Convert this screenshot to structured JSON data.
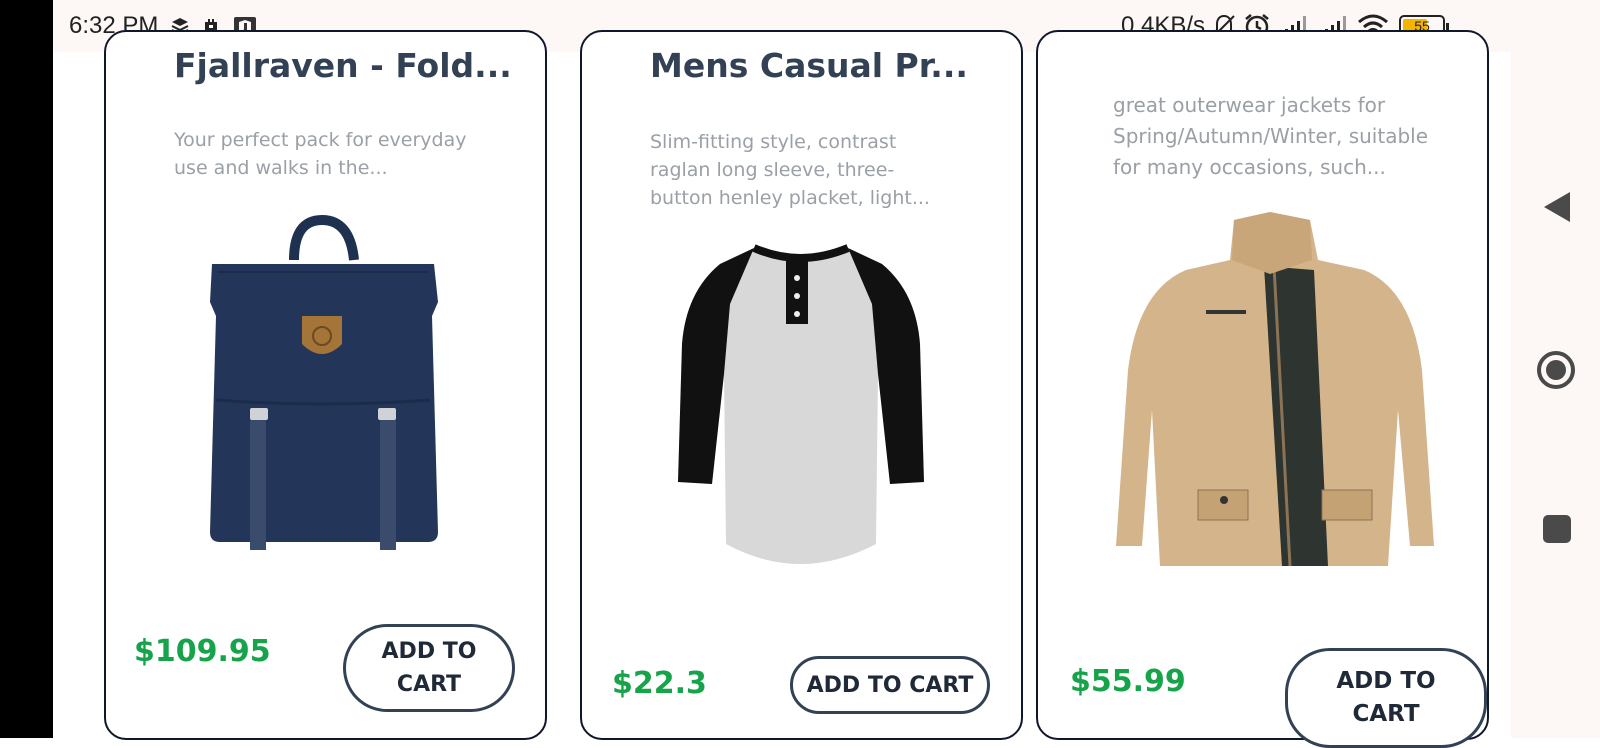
{
  "status_bar": {
    "time": "6:32 PM",
    "network_speed": "0.4KB/s",
    "battery": "55",
    "icons": [
      "layers-icon",
      "notification-icon",
      "app-icon",
      "mute-bell-icon",
      "alarm-icon",
      "signal-icon",
      "signal-icon",
      "wifi-icon",
      "battery-icon"
    ]
  },
  "products": [
    {
      "title": "Fjallraven - Fold...",
      "description": "Your perfect pack for everyday use and walks in the...",
      "price": "$109.95",
      "button": "ADD TO CART",
      "image": "navy-backpack"
    },
    {
      "title": "Mens Casual Pr...",
      "description": "Slim-fitting style, contrast raglan long sleeve, three-button henley placket, light...",
      "price": "$22.3",
      "button": "ADD TO CART",
      "image": "raglan-henley-shirt"
    },
    {
      "title": "",
      "description": "great outerwear jackets for Spring/Autumn/Winter, suitable for many occasions, such...",
      "price": "$55.99",
      "button": "ADD TO CART",
      "image": "khaki-jacket"
    }
  ],
  "navigation": {
    "icons": [
      "back-icon",
      "home-icon",
      "recents-icon"
    ]
  }
}
